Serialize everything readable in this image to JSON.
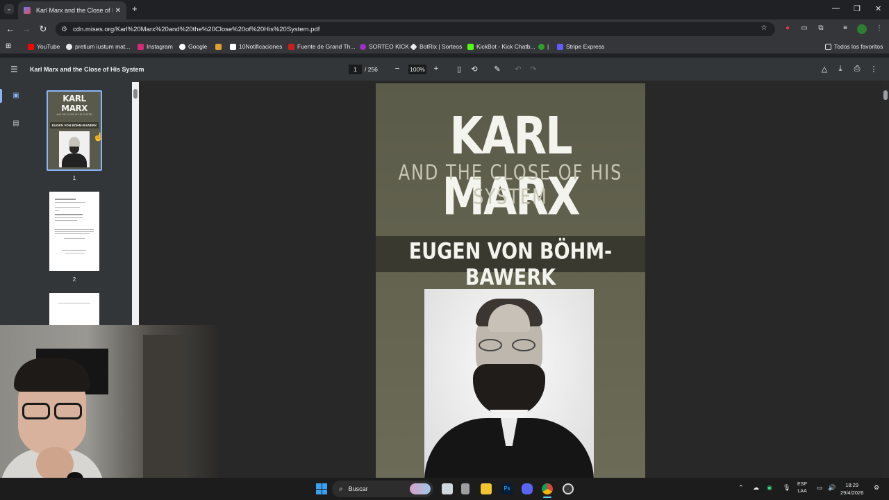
{
  "tab": {
    "title": "Karl Marx and the Close of His S",
    "close": "✕",
    "new": "+"
  },
  "window": {
    "minimize": "—",
    "restore": "❐",
    "close": "✕"
  },
  "omnibox": {
    "url": "cdn.mises.org/Karl%20Marx%20and%20the%20Close%20of%20His%20System.pdf"
  },
  "bookmarks": {
    "items": [
      {
        "label": "YouTube",
        "color": "#ff0000"
      },
      {
        "label": "pretium iustum mat...",
        "color": "#e8eaed"
      },
      {
        "label": "Instagram",
        "color": "#d62976"
      },
      {
        "label": "Google",
        "color": "#ffffff"
      },
      {
        "label": "",
        "color": "#e0a030"
      },
      {
        "label": "10Notificaciones",
        "color": "#ffffff"
      },
      {
        "label": "Fuente de Grand Th...",
        "color": "#c81e1e"
      },
      {
        "label": "SORTEO KICK",
        "color": "#9b30c8"
      },
      {
        "label": "BotRix | Sorteos",
        "color": "#e8eaed"
      },
      {
        "label": "KickBot - Kick Chatb...",
        "color": "#53fc18"
      },
      {
        "label": "|",
        "color": "#2ca02c"
      },
      {
        "label": "Stripe Express",
        "color": "#635bff"
      }
    ],
    "all": "Todos los favoritos"
  },
  "pdf": {
    "title": "Karl Marx and the Close of His System",
    "page": "1",
    "total": "/ 256",
    "zoom": "100%",
    "zoom_out": "−",
    "zoom_in": "+"
  },
  "thumbs": {
    "n1": "1",
    "n2": "2"
  },
  "cover": {
    "title": "KARL MARX",
    "subtitle": "AND THE CLOSE OF HIS SYSTEM",
    "author": "EUGEN VON BÖHM-BAWERK"
  },
  "taskbar": {
    "search": "Buscar",
    "lang1": "ESP",
    "lang2": "LAA",
    "time": "18:29",
    "date": "29/4/2026"
  }
}
